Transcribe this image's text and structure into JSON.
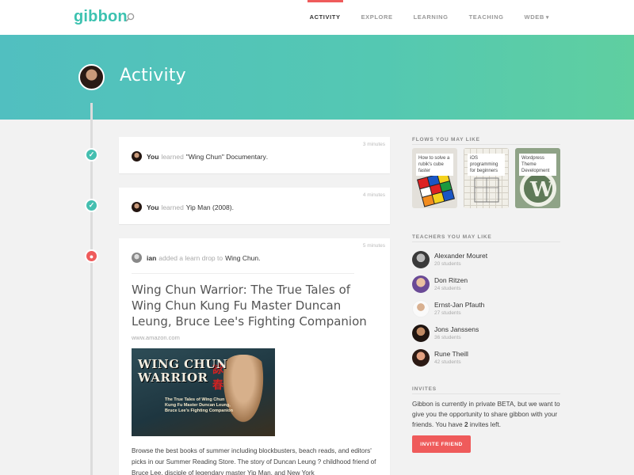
{
  "header": {
    "logo": "gibbon",
    "search_icon": "search-icon",
    "nav": [
      {
        "label": "ACTIVITY",
        "active": true
      },
      {
        "label": "EXPLORE",
        "active": false
      },
      {
        "label": "LEARNING",
        "active": false
      },
      {
        "label": "TEACHING",
        "active": false
      },
      {
        "label": "WDEB",
        "active": false,
        "dropdown": true
      }
    ],
    "accent_color": "#ef5b5b"
  },
  "hero": {
    "title": "Activity",
    "gradient": [
      "#51bfc0",
      "#5fcfa0"
    ]
  },
  "feed": [
    {
      "time": "3 minutes",
      "icon": "check-icon",
      "actor": "You",
      "verb": "learned",
      "object": "\"Wing Chun\" Documentary",
      "suffix": "."
    },
    {
      "time": "4 minutes",
      "icon": "check-icon",
      "actor": "You",
      "verb": "learned",
      "object": "Yip Man (2008)",
      "suffix": "."
    },
    {
      "time": "5 minutes",
      "icon": "drop-icon",
      "actor": "ian",
      "verb": "added a learn drop to",
      "object": "Wing Chun",
      "suffix": ".",
      "title": "Wing Chun Warrior: The True Tales of Wing Chun Kung Fu Master Duncan Leung, Bruce Lee's Fighting Companion",
      "source": "www.amazon.com",
      "book_title": "WING CHUN WARRIOR",
      "book_subtitle": "The True Tales of Wing Chun Kung Fu Master Duncan Leung, Bruce Lee's Fighting Companion",
      "description": "Browse the best books of summer including blockbusters, beach reads, and editors' picks in our Summer Reading Store. The story of Duncan Leung ? childhood friend of Bruce Lee, disciple of legendary master Yip Man, and New York"
    }
  ],
  "flows": {
    "title": "FLOWS YOU MAY LIKE",
    "items": [
      {
        "label": "How to solve a rubik's cube faster"
      },
      {
        "label": "iOS programming for beginners"
      },
      {
        "label": "Wordpress Theme Development"
      }
    ]
  },
  "teachers": {
    "title": "TEACHERS YOU MAY LIKE",
    "items": [
      {
        "name": "Alexander Mouret",
        "students": "20 students"
      },
      {
        "name": "Don Ritzen",
        "students": "24 students"
      },
      {
        "name": "Ernst-Jan Pfauth",
        "students": "27 students"
      },
      {
        "name": "Jons Janssens",
        "students": "36 students"
      },
      {
        "name": "Rune Theill",
        "students": "42 students"
      }
    ]
  },
  "invites": {
    "title": "INVITES",
    "text_before": "Gibbon is currently in private BETA, but we want to give you the opportunity to share gibbon with your friends. You have ",
    "count": "2",
    "text_after": " invites left.",
    "button": "INVITE FRIEND"
  }
}
